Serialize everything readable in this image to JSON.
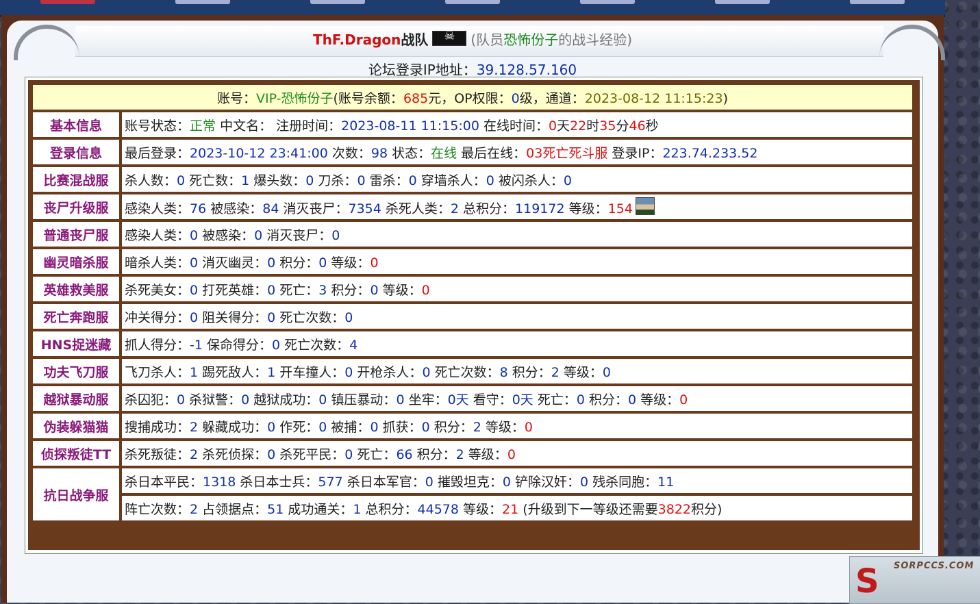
{
  "header": {
    "team_name": "ThF.Dragon",
    "team_suffix": "战队",
    "member_open": "(队员",
    "member_name": "恐怖份子",
    "member_close": "的战斗经验)"
  },
  "ip_line": {
    "label": "论坛登录IP地址：",
    "value": "39.128.57.160"
  },
  "account": {
    "label": "账号：",
    "vip": "VIP-恐怖份子",
    "balance_label": "(账号余额：",
    "balance": "685",
    "balance_unit": "元，",
    "op_label": "OP权限：",
    "op": "0",
    "op_unit": "级，",
    "channel_label": "通道：",
    "channel_time": "2023-08-12 11:15:23",
    "close": ")"
  },
  "rows": [
    {
      "label": "基本信息",
      "items": [
        {
          "k": "账号状态：",
          "v": "正常",
          "c": "green"
        },
        {
          "k": " 中文名： 注册时间：",
          "v": "2023-08-11 11:15:00",
          "c": "blue"
        },
        {
          "k": " 在线时间：",
          "v": "0",
          "c": "red"
        },
        {
          "k": "天",
          "v": "22",
          "c": "red"
        },
        {
          "k": "时",
          "v": "35",
          "c": "red"
        },
        {
          "k": "分",
          "v": "46",
          "c": "red"
        },
        {
          "k": "秒",
          "v": "",
          "c": ""
        }
      ]
    },
    {
      "label": "登录信息",
      "items": [
        {
          "k": "最后登录：",
          "v": "2023-10-12 23:41:00",
          "c": "blue"
        },
        {
          "k": " 次数：",
          "v": "98",
          "c": "blue"
        },
        {
          "k": " 状态：",
          "v": "在线",
          "c": "green"
        },
        {
          "k": " 最后在线：",
          "v": "03死亡死斗服",
          "c": "red"
        },
        {
          "k": " 登录IP：",
          "v": "223.74.233.52",
          "c": "blue"
        }
      ]
    },
    {
      "label": "比赛混战服",
      "items": [
        {
          "k": "杀人数：",
          "v": "0",
          "c": "blue"
        },
        {
          "k": " 死亡数：",
          "v": "1",
          "c": "blue"
        },
        {
          "k": " 爆头数：",
          "v": "0",
          "c": "blue"
        },
        {
          "k": " 刀杀：",
          "v": "0",
          "c": "blue"
        },
        {
          "k": " 雷杀：",
          "v": "0",
          "c": "blue"
        },
        {
          "k": " 穿墙杀人：",
          "v": "0",
          "c": "blue"
        },
        {
          "k": " 被闪杀人：",
          "v": "0",
          "c": "blue"
        }
      ]
    },
    {
      "label": "丧尸升级服",
      "avatar": true,
      "items": [
        {
          "k": "感染人类：",
          "v": "76",
          "c": "blue"
        },
        {
          "k": " 被感染：",
          "v": "84",
          "c": "blue"
        },
        {
          "k": " 消灭丧尸：",
          "v": "7354",
          "c": "blue"
        },
        {
          "k": " 杀死人类：",
          "v": "2",
          "c": "blue"
        },
        {
          "k": " 总积分：",
          "v": "119172",
          "c": "blue"
        },
        {
          "k": " 等级：",
          "v": "154",
          "c": "red"
        }
      ]
    },
    {
      "label": "普通丧尸服",
      "items": [
        {
          "k": "感染人类：",
          "v": "0",
          "c": "blue"
        },
        {
          "k": " 被感染：",
          "v": "0",
          "c": "blue"
        },
        {
          "k": " 消灭丧尸：",
          "v": "0",
          "c": "blue"
        }
      ]
    },
    {
      "label": "幽灵暗杀服",
      "items": [
        {
          "k": "暗杀人类：",
          "v": "0",
          "c": "blue"
        },
        {
          "k": " 消灭幽灵：",
          "v": "0",
          "c": "blue"
        },
        {
          "k": " 积分：",
          "v": "0",
          "c": "blue"
        },
        {
          "k": " 等级：",
          "v": "0",
          "c": "red"
        }
      ]
    },
    {
      "label": "英雄救美服",
      "items": [
        {
          "k": "杀死美女：",
          "v": "0",
          "c": "blue"
        },
        {
          "k": " 打死英雄：",
          "v": "0",
          "c": "blue"
        },
        {
          "k": " 死亡：",
          "v": "3",
          "c": "blue"
        },
        {
          "k": " 积分：",
          "v": "0",
          "c": "blue"
        },
        {
          "k": " 等级：",
          "v": "0",
          "c": "red"
        }
      ]
    },
    {
      "label": "死亡奔跑服",
      "items": [
        {
          "k": "冲关得分：",
          "v": "0",
          "c": "blue"
        },
        {
          "k": " 阻关得分：",
          "v": "0",
          "c": "blue"
        },
        {
          "k": " 死亡次数：",
          "v": "0",
          "c": "blue"
        }
      ]
    },
    {
      "label": "HNS捉迷藏",
      "items": [
        {
          "k": "抓人得分：",
          "v": "-1",
          "c": "blue"
        },
        {
          "k": " 保命得分：",
          "v": "0",
          "c": "blue"
        },
        {
          "k": " 死亡次数：",
          "v": "4",
          "c": "blue"
        }
      ]
    },
    {
      "label": "功夫飞刀服",
      "items": [
        {
          "k": "飞刀杀人：",
          "v": "1",
          "c": "blue"
        },
        {
          "k": " 踢死敌人：",
          "v": "1",
          "c": "blue"
        },
        {
          "k": " 开车撞人：",
          "v": "0",
          "c": "blue"
        },
        {
          "k": " 开枪杀人：",
          "v": "0",
          "c": "blue"
        },
        {
          "k": " 死亡次数：",
          "v": "8",
          "c": "blue"
        },
        {
          "k": " 积分：",
          "v": "2",
          "c": "blue"
        },
        {
          "k": " 等级：",
          "v": "0",
          "c": "blue"
        }
      ]
    },
    {
      "label": "越狱暴动服",
      "items": [
        {
          "k": "杀囚犯：",
          "v": "0",
          "c": "blue"
        },
        {
          "k": " 杀狱警：",
          "v": "0",
          "c": "blue"
        },
        {
          "k": " 越狱成功：",
          "v": "0",
          "c": "blue"
        },
        {
          "k": " 镇压暴动：",
          "v": "0",
          "c": "blue"
        },
        {
          "k": " 坐牢：",
          "v": "0天",
          "c": "blue"
        },
        {
          "k": " 看守：",
          "v": "0天",
          "c": "blue"
        },
        {
          "k": " 死亡：",
          "v": "0",
          "c": "blue"
        },
        {
          "k": " 积分：",
          "v": "0",
          "c": "blue"
        },
        {
          "k": " 等级：",
          "v": "0",
          "c": "red"
        }
      ]
    },
    {
      "label": "伪装躲猫猫",
      "items": [
        {
          "k": "搜捕成功：",
          "v": "2",
          "c": "blue"
        },
        {
          "k": " 躲藏成功：",
          "v": "0",
          "c": "blue"
        },
        {
          "k": " 作死：",
          "v": "0",
          "c": "blue"
        },
        {
          "k": " 被捕：",
          "v": "0",
          "c": "blue"
        },
        {
          "k": " 抓获：",
          "v": "0",
          "c": "blue"
        },
        {
          "k": " 积分：",
          "v": "2",
          "c": "blue"
        },
        {
          "k": " 等级：",
          "v": "0",
          "c": "red"
        }
      ]
    },
    {
      "label": "侦探叛徒TT",
      "items": [
        {
          "k": "杀死叛徒：",
          "v": "2",
          "c": "blue"
        },
        {
          "k": " 杀死侦探：",
          "v": "0",
          "c": "blue"
        },
        {
          "k": " 杀死平民：",
          "v": "0",
          "c": "blue"
        },
        {
          "k": " 死亡：",
          "v": "66",
          "c": "blue"
        },
        {
          "k": " 积分：",
          "v": "2",
          "c": "blue"
        },
        {
          "k": " 等级：",
          "v": "0",
          "c": "red"
        }
      ]
    }
  ],
  "antijapan": {
    "label": "抗日战争服",
    "line1": [
      {
        "k": "杀日本平民：",
        "v": "1318",
        "c": "blue"
      },
      {
        "k": " 杀日本士兵：",
        "v": "577",
        "c": "blue"
      },
      {
        "k": " 杀日本军官：",
        "v": "0",
        "c": "blue"
      },
      {
        "k": " 摧毁坦克：",
        "v": "0",
        "c": "blue"
      },
      {
        "k": " 铲除汉奸：",
        "v": "0",
        "c": "blue"
      },
      {
        "k": " 残杀同胞：",
        "v": "11",
        "c": "blue"
      }
    ],
    "line2": [
      {
        "k": "阵亡次数：",
        "v": "2",
        "c": "blue"
      },
      {
        "k": " 占领据点：",
        "v": "51",
        "c": "blue"
      },
      {
        "k": " 成功通关：",
        "v": "1",
        "c": "blue"
      },
      {
        "k": " 总积分：",
        "v": "44578",
        "c": "blue"
      },
      {
        "k": " 等级：",
        "v": "21",
        "c": "red"
      },
      {
        "k": " (升级到下一等级还需要",
        "v": "3822",
        "c": "red"
      },
      {
        "k": "积分)",
        "v": "",
        "c": ""
      }
    ]
  },
  "watermark": {
    "text": "SORPCCS.COM"
  }
}
